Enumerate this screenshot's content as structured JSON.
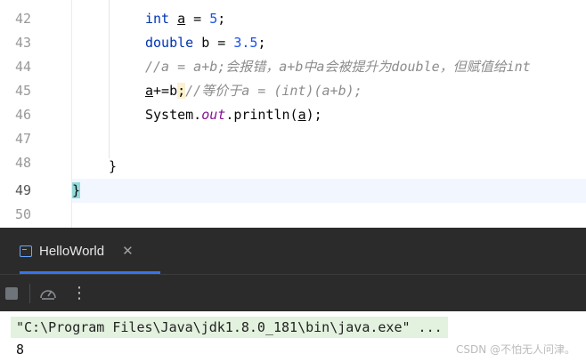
{
  "editor": {
    "line_numbers": [
      "42",
      "43",
      "44",
      "45",
      "46",
      "47",
      "48",
      "49",
      "50"
    ],
    "lines": {
      "l42": {
        "kw": "int",
        "var": "a",
        "rest": " = ",
        "num": "5",
        "end": ";"
      },
      "l43": {
        "kw": "double",
        "rest": " b = ",
        "num": "3.5",
        "end": ";"
      },
      "l44": {
        "comment": "//a = a+b;会报错，a+b中a会被提升为double，但赋值给int"
      },
      "l45": {
        "var": "a",
        "op": "+=b",
        "semi": ";",
        "comment": "//等价于a = (int)(a+b);"
      },
      "l46": {
        "pre": "System.",
        "field": "out",
        "mid": ".println(",
        "arg": "a",
        "end": ");"
      },
      "l48": {
        "brace": "}"
      },
      "l49": {
        "brace": "}"
      }
    }
  },
  "run_panel": {
    "tab_label": "HelloWorld",
    "close_glyph": "✕",
    "more_glyph": "⋮",
    "command": "\"C:\\Program Files\\Java\\jdk1.8.0_181\\bin\\java.exe\" ...",
    "output": "8"
  },
  "watermark": "CSDN @不怕无人问津。",
  "colors": {
    "keyword": "#0033b3",
    "number": "#1750eb",
    "comment": "#8c8c8c",
    "field": "#871094",
    "panel_bg": "#2b2b2b",
    "tab_accent": "#3574f0",
    "command_highlight": "#e3f1df",
    "brace_match": "#93d9d9"
  }
}
